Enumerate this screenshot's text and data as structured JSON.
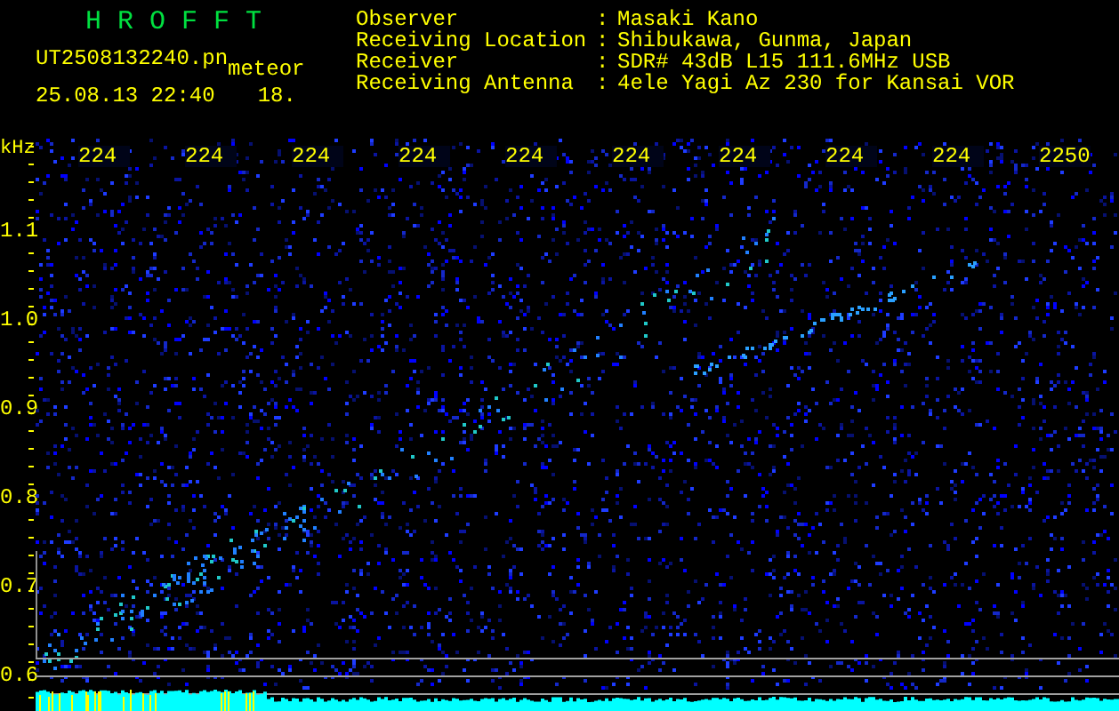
{
  "header": {
    "title": "H R O F F T",
    "filename": "UT2508132240.pn",
    "tag": "meteor",
    "datetime": "25.08.13 22:40",
    "value": "18.",
    "fields": [
      {
        "label": "Observer",
        "separator": ":",
        "value": "Masaki Kano"
      },
      {
        "label": "Receiving Location",
        "separator": ":",
        "value": "Shibukawa, Gunma, Japan"
      },
      {
        "label": "Receiver",
        "separator": ":",
        "value": "SDR# 43dB L15 111.6MHz USB"
      },
      {
        "label": "Receiving Antenna",
        "separator": ":",
        "value": "4ele Yagi Az 230 for Kansai VOR"
      }
    ]
  },
  "plot": {
    "y_unit": "kHz",
    "y_labels": [
      "1.1",
      "1.0",
      "0.9",
      "0.8",
      "0.7",
      "0.6"
    ],
    "time_labels": [
      "224",
      "224",
      "224",
      "224",
      "224",
      "224",
      "224",
      "224",
      "224",
      "2250"
    ]
  }
}
